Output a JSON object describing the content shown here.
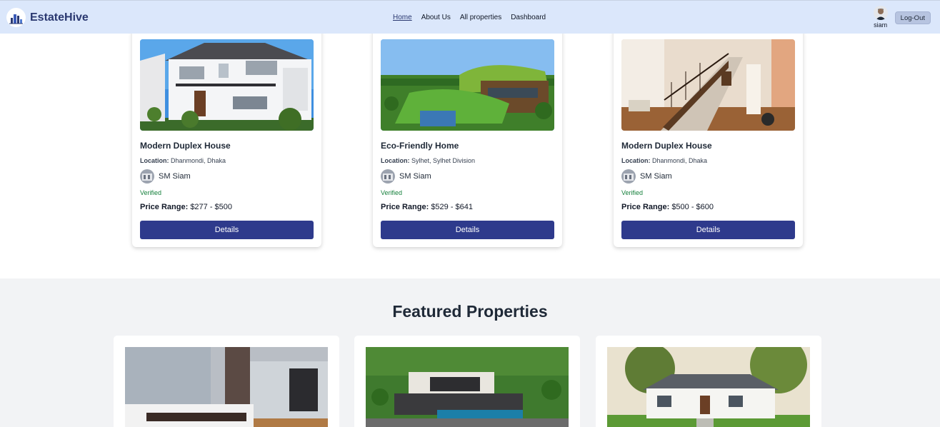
{
  "brand": {
    "name": "EstateHive"
  },
  "nav": {
    "links": [
      "Home",
      "About Us",
      "All properties",
      "Dashboard"
    ],
    "active": "Home"
  },
  "user": {
    "name": "siam",
    "logout_label": "Log-Out"
  },
  "colors": {
    "navbar": "#dbe7fb",
    "brand": "#2a3870",
    "button": "#2e3a8c",
    "verified": "#16803c",
    "featured_bg": "#f2f3f5"
  },
  "cards": [
    {
      "title": "Modern Duplex House",
      "location_label": "Location:",
      "location": "Dhanmondi, Dhaka",
      "agent": "SM Siam",
      "status": "Verified",
      "price_label": "Price Range:",
      "price": "$277 - $500",
      "button": "Details"
    },
    {
      "title": "Eco-Friendly Home",
      "location_label": "Location:",
      "location": "Sylhet, Sylhet Division",
      "agent": "SM Siam",
      "status": "Verified",
      "price_label": "Price Range:",
      "price": "$529 - $641",
      "button": "Details"
    },
    {
      "title": "Modern Duplex House",
      "location_label": "Location:",
      "location": "Dhanmondi, Dhaka",
      "agent": "SM Siam",
      "status": "Verified",
      "price_label": "Price Range:",
      "price": "$500 - $600",
      "button": "Details"
    }
  ],
  "featured": {
    "title": "Featured Properties"
  }
}
